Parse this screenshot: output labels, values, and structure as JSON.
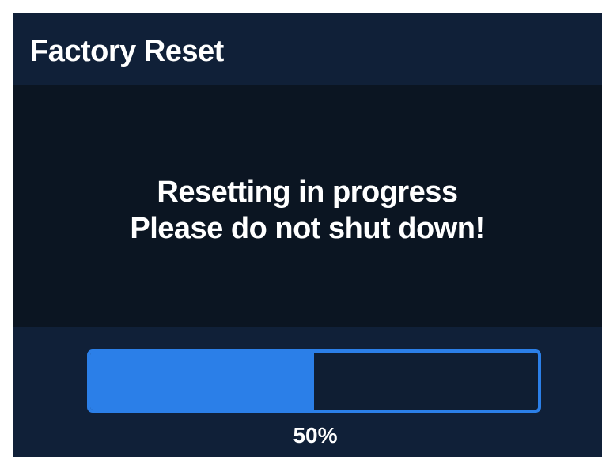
{
  "dialog": {
    "title": "Factory Reset",
    "message_line1": "Resetting in progress",
    "message_line2": "Please do not shut down!"
  },
  "progress": {
    "value": 0.5,
    "label": "50%"
  },
  "colors": {
    "header_background": "#102038",
    "message_background": "#0b1522",
    "accent": "#2b7fe8",
    "text": "#ffffff"
  }
}
